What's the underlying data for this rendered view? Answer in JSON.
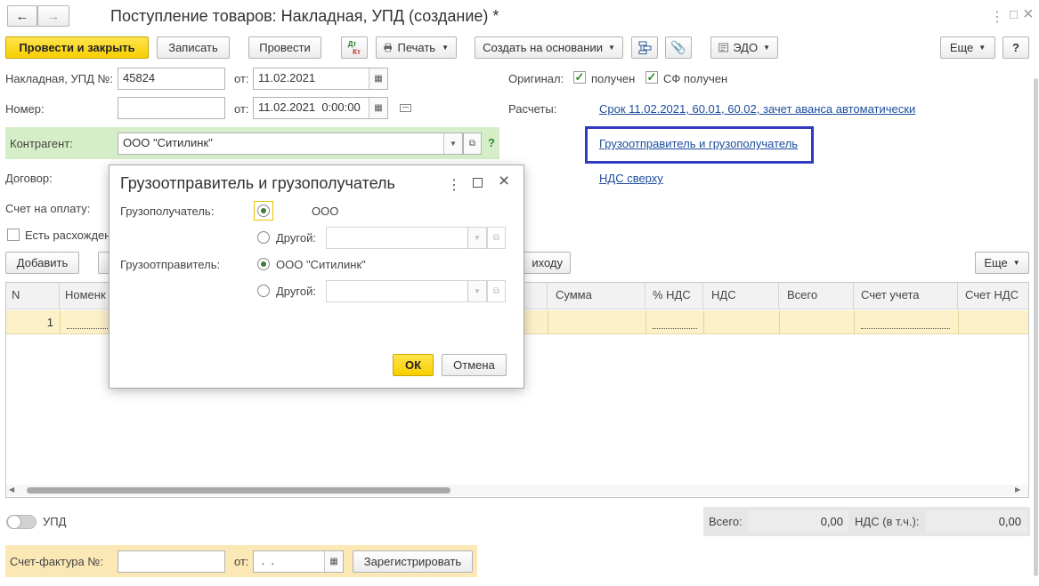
{
  "window": {
    "title": "Поступление товаров: Накладная, УПД (создание) *",
    "back_icon": "←",
    "forward_icon": "→",
    "more_icon": "⋮",
    "maximize_icon": "□",
    "close_icon": "×"
  },
  "toolbar": {
    "post_close": "Провести и закрыть",
    "save": "Записать",
    "post": "Провести",
    "dtkt_top": "Дт",
    "dtkt_bottom": "Кт",
    "print": "Печать",
    "create_based": "Создать на основании",
    "edo": "ЭДО",
    "more": "Еще",
    "help": "?"
  },
  "form": {
    "invoice_label": "Накладная, УПД №:",
    "invoice_number": "45824",
    "from_label": "от:",
    "invoice_date": "11.02.2021",
    "number_label": "Номер:",
    "number_value": "",
    "from_label2": "от:",
    "number_datetime": "11.02.2021  0:00:00",
    "original_label": "Оригинал:",
    "received_label": "получен",
    "received_checked": true,
    "sf_received_label": "СФ получен",
    "sf_received_checked": true,
    "settlements_label": "Расчеты:",
    "settlements_link": "Срок 11.02.2021, 60.01, 60.02, зачет аванса автоматически",
    "counterparty_label": "Контрагент:",
    "counterparty_value": "ООО \"Ситилинк\"",
    "counterparty_help": "?",
    "shipper_link": "Грузоотправитель и грузополучатель",
    "contract_label": "Договор:",
    "vat_link": "НДС сверху",
    "payment_invoice_label": "Счет на оплату:",
    "discrepancy_label": "Есть расхожден"
  },
  "table_toolbar": {
    "add": "Добавить",
    "receipt_fragment": "иходу",
    "more": "Еще"
  },
  "table": {
    "columns": [
      "N",
      "Номенк",
      "Сумма",
      "% НДС",
      "НДС",
      "Всего",
      "Счет учета",
      "Счет НДС"
    ],
    "rows": [
      {
        "n": "1"
      }
    ]
  },
  "footer": {
    "upd_label": "УПД",
    "total_label": "Всего:",
    "total_value": "0,00",
    "vat_total_label": "НДС (в т.ч.):",
    "vat_total_value": "0,00",
    "invoice_label": "Счет-фактура №:",
    "invoice_value": "",
    "from_label": "от:",
    "invoice_date": " .  .",
    "register": "Зарегистрировать"
  },
  "dialog": {
    "title": "Грузоотправитель и грузополучатель",
    "consignee_label": "Грузополучатель:",
    "consignee_value": "ООО",
    "other_label": "Другой:",
    "shipper_label": "Грузоотправитель:",
    "shipper_value": "ООО \"Ситилинк\"",
    "other_label2": "Другой:",
    "ok": "ОК",
    "cancel": "Отмена"
  },
  "colors": {
    "accent_yellow": "#f8cf00",
    "counterparty_bg": "#d6eec8",
    "highlight_border": "#2f3bbf",
    "link": "#1c4d9c",
    "row_highlight": "#fbf0c8",
    "invoice_bar_bg": "#fbe8b4"
  }
}
